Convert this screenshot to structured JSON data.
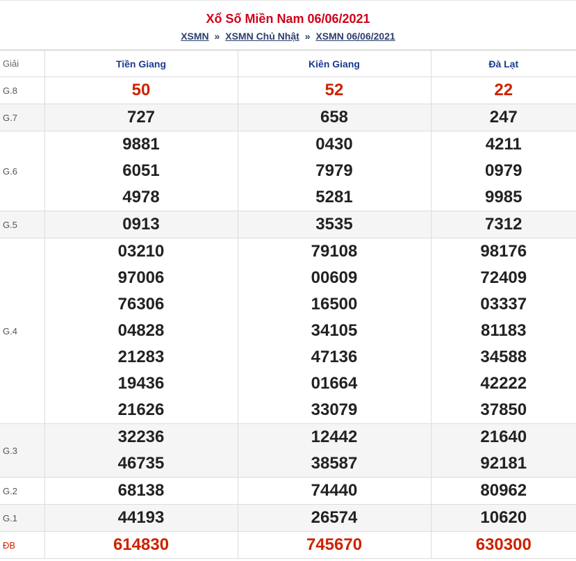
{
  "title": "Xổ Số Miền Nam 06/06/2021",
  "breadcrumb": [
    "XSMN",
    "XSMN Chủ Nhật",
    "XSMN 06/06/2021"
  ],
  "breadcrumb_sep": "»",
  "table": {
    "header_label": "Giải",
    "provinces": [
      "Tiền Giang",
      "Kiên Giang",
      "Đà Lạt"
    ],
    "prizes": [
      {
        "label": "G.8",
        "highlight": true,
        "alt": false,
        "values": [
          [
            "50"
          ],
          [
            "52"
          ],
          [
            "22"
          ]
        ]
      },
      {
        "label": "G.7",
        "highlight": false,
        "alt": true,
        "values": [
          [
            "727"
          ],
          [
            "658"
          ],
          [
            "247"
          ]
        ]
      },
      {
        "label": "G.6",
        "highlight": false,
        "alt": false,
        "values": [
          [
            "9881",
            "6051",
            "4978"
          ],
          [
            "0430",
            "7979",
            "5281"
          ],
          [
            "4211",
            "0979",
            "9985"
          ]
        ]
      },
      {
        "label": "G.5",
        "highlight": false,
        "alt": true,
        "values": [
          [
            "0913"
          ],
          [
            "3535"
          ],
          [
            "7312"
          ]
        ]
      },
      {
        "label": "G.4",
        "highlight": false,
        "alt": false,
        "values": [
          [
            "03210",
            "97006",
            "76306",
            "04828",
            "21283",
            "19436",
            "21626"
          ],
          [
            "79108",
            "00609",
            "16500",
            "34105",
            "47136",
            "01664",
            "33079"
          ],
          [
            "98176",
            "72409",
            "03337",
            "81183",
            "34588",
            "42222",
            "37850"
          ]
        ]
      },
      {
        "label": "G.3",
        "highlight": false,
        "alt": true,
        "values": [
          [
            "32236",
            "46735"
          ],
          [
            "12442",
            "38587"
          ],
          [
            "21640",
            "92181"
          ]
        ]
      },
      {
        "label": "G.2",
        "highlight": false,
        "alt": false,
        "values": [
          [
            "68138"
          ],
          [
            "74440"
          ],
          [
            "80962"
          ]
        ]
      },
      {
        "label": "G.1",
        "highlight": false,
        "alt": true,
        "values": [
          [
            "44193"
          ],
          [
            "26574"
          ],
          [
            "10620"
          ]
        ]
      },
      {
        "label": "ĐB",
        "highlight": true,
        "alt": false,
        "special": true,
        "values": [
          [
            "614830"
          ],
          [
            "745670"
          ],
          [
            "630300"
          ]
        ]
      }
    ]
  },
  "colors": {
    "title": "#d0021b",
    "highlight": "#cc2200",
    "header": "#1a3a8f",
    "link": "#2b3f6b"
  }
}
